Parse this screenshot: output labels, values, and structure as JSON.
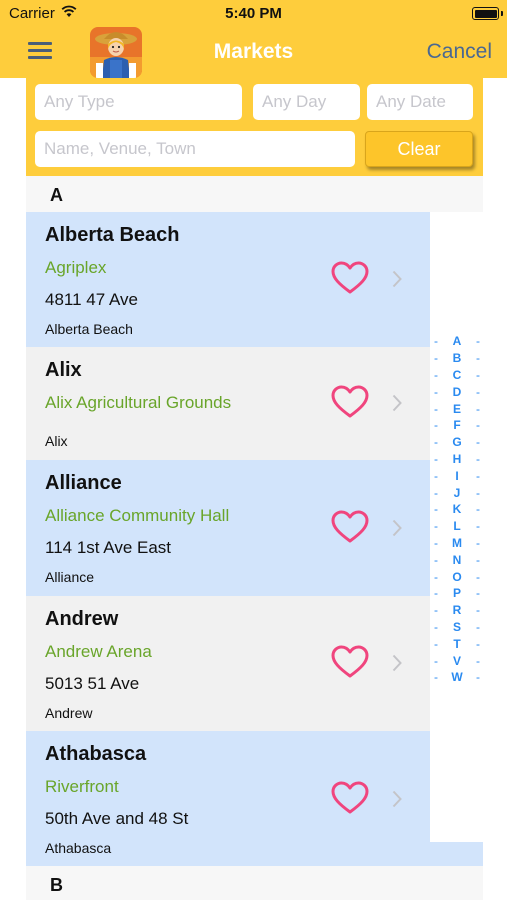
{
  "status_bar": {
    "carrier": "Carrier",
    "time": "5:40 PM"
  },
  "nav": {
    "title": "Markets",
    "cancel_label": "Cancel",
    "menu_icon": "hamburger-menu-icon",
    "logo_icon": "farmer-logo-icon"
  },
  "filters": {
    "type_placeholder": "Any Type",
    "day_placeholder": "Any Day",
    "date_placeholder": "Any Date",
    "search_placeholder": "Name, Venue, Town",
    "clear_label": "Clear"
  },
  "sections": [
    {
      "letter": "A",
      "markets": [
        {
          "name": "Alberta Beach",
          "venue": "Agriplex",
          "address": "4811 47 Ave",
          "town": "Alberta Beach",
          "favorite": false
        },
        {
          "name": "Alix",
          "venue": "Alix Agricultural Grounds",
          "address": "",
          "town": "Alix",
          "favorite": false
        },
        {
          "name": "Alliance",
          "venue": "Alliance Community Hall",
          "address": "114 1st Ave East",
          "town": "Alliance",
          "favorite": false
        },
        {
          "name": "Andrew",
          "venue": "Andrew Arena",
          "address": "5013 51 Ave",
          "town": "Andrew",
          "favorite": false
        },
        {
          "name": "Athabasca",
          "venue": "Riverfront",
          "address": "50th Ave and 48 St",
          "town": "Athabasca",
          "favorite": false
        }
      ]
    },
    {
      "letter": "B",
      "markets": []
    }
  ],
  "index_letters": [
    "A",
    "B",
    "C",
    "D",
    "E",
    "F",
    "G",
    "H",
    "I",
    "J",
    "K",
    "L",
    "M",
    "N",
    "O",
    "P",
    "R",
    "S",
    "T",
    "V",
    "W"
  ],
  "colors": {
    "bar_yellow": "#fecd3c",
    "row_blue": "#d2e4fb",
    "row_gray": "#f1f1f1",
    "venue_green": "#69a52a",
    "heart_pink": "#f0457e",
    "index_blue": "#2a8af0"
  }
}
